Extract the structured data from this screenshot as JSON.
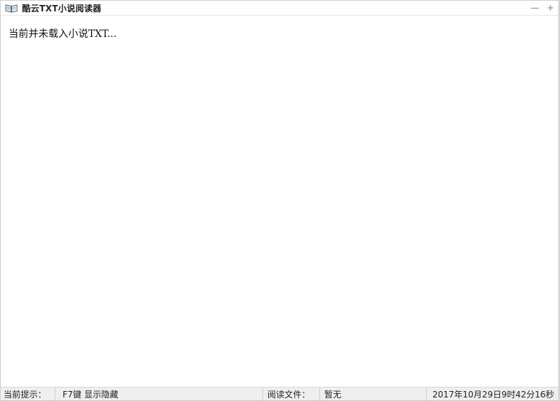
{
  "window": {
    "title": "酷云TXT小说阅读器",
    "controls": {
      "minimize": "—",
      "maximize": "+"
    }
  },
  "main": {
    "message": "当前并未载入小说TXT..."
  },
  "statusbar": {
    "hint_label": "当前提示：",
    "hint_value": "F7键 显示隐藏",
    "file_label": "阅读文件：",
    "file_value": "暂无",
    "datetime": "2017年10月29日9时42分16秒"
  },
  "colors": {
    "background": "#ffffff",
    "statusbar": "#efefef",
    "border": "#cfcfcf"
  },
  "icons": {
    "app": "open-book-icon"
  }
}
